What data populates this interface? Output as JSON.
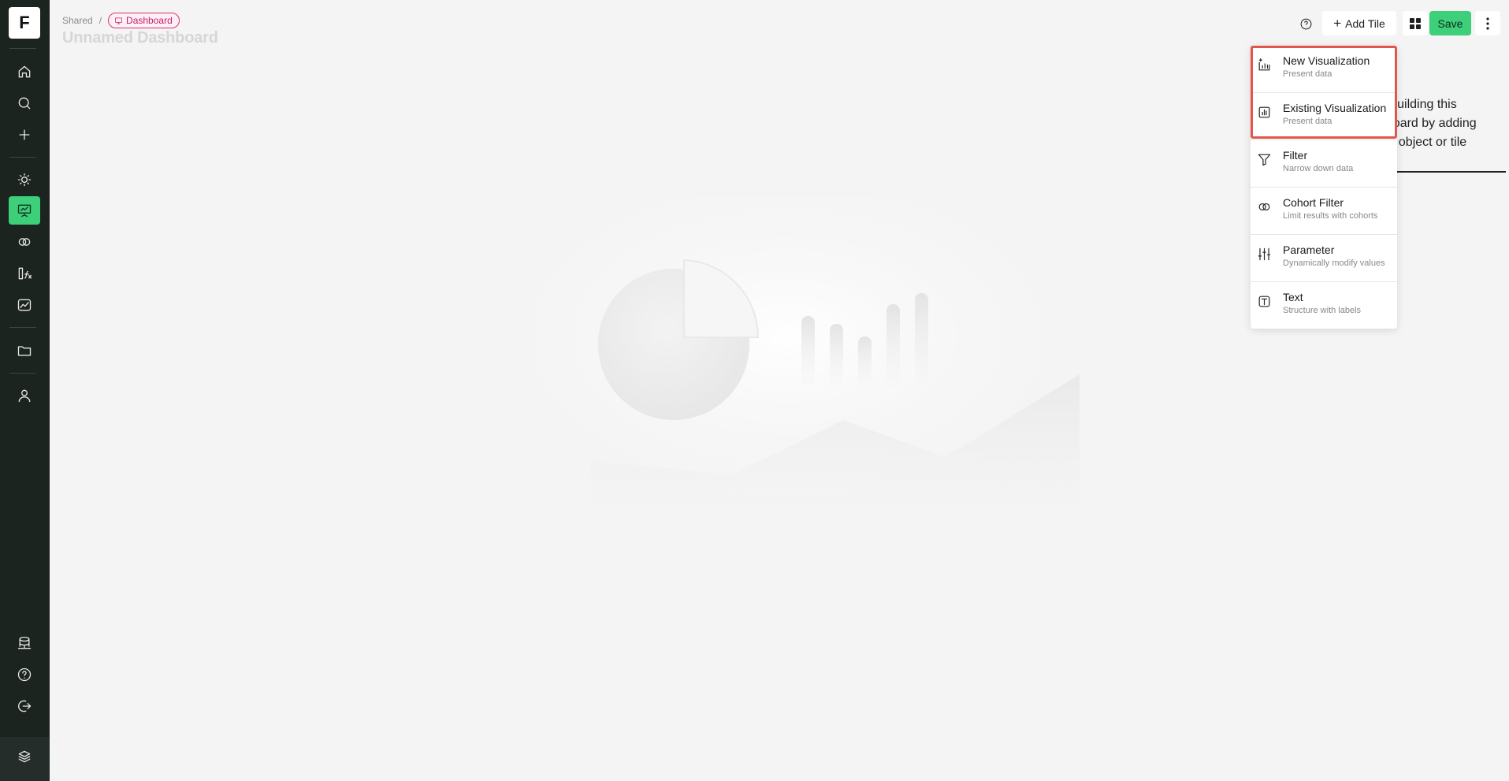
{
  "sidebar": {
    "logo": "F",
    "items": [
      {
        "name": "home",
        "icon": "home-icon"
      },
      {
        "name": "search",
        "icon": "search-icon"
      },
      {
        "name": "create",
        "icon": "plus-icon"
      },
      {
        "name": "insights",
        "icon": "lightbulb-icon"
      },
      {
        "name": "dashboards",
        "icon": "presentation-icon",
        "active": true
      },
      {
        "name": "cohorts",
        "icon": "cohort-icon"
      },
      {
        "name": "metrics",
        "icon": "formula-icon"
      },
      {
        "name": "reports",
        "icon": "chart-line-icon"
      },
      {
        "name": "files",
        "icon": "folder-icon"
      },
      {
        "name": "users",
        "icon": "user-icon"
      },
      {
        "name": "data-sources",
        "icon": "database-icon"
      },
      {
        "name": "help",
        "icon": "help-icon"
      },
      {
        "name": "logout",
        "icon": "logout-icon"
      },
      {
        "name": "brand",
        "icon": "brand-layers-icon"
      }
    ],
    "active_color": "#3ecf7a",
    "background": "#1c2420"
  },
  "header": {
    "breadcrumb_root": "Shared",
    "breadcrumb_separator": "/",
    "breadcrumb_badge": "Dashboard",
    "title": "Unnamed Dashboard"
  },
  "toolbar": {
    "add_tile_label": "Add Tile",
    "save_label": "Save",
    "save_color": "#3ecf7a"
  },
  "empty_state": {
    "hint_line1": "rt building this",
    "hint_line2": "hboard by adding",
    "hint_line3": "ew object or tile"
  },
  "add_tile_menu": {
    "items": [
      {
        "label": "New Visualization",
        "sub": "Present data",
        "icon": "new-visualization-icon"
      },
      {
        "label": "Existing Visualization",
        "sub": "Present data",
        "icon": "existing-visualization-icon"
      },
      {
        "label": "Filter",
        "sub": "Narrow down data",
        "icon": "filter-icon"
      },
      {
        "label": "Cohort Filter",
        "sub": "Limit results with cohorts",
        "icon": "cohort-filter-icon"
      },
      {
        "label": "Parameter",
        "sub": "Dynamically modify values",
        "icon": "sliders-icon"
      },
      {
        "label": "Text",
        "sub": "Structure with labels",
        "icon": "text-icon"
      }
    ],
    "highlight_color": "#e0584b"
  }
}
